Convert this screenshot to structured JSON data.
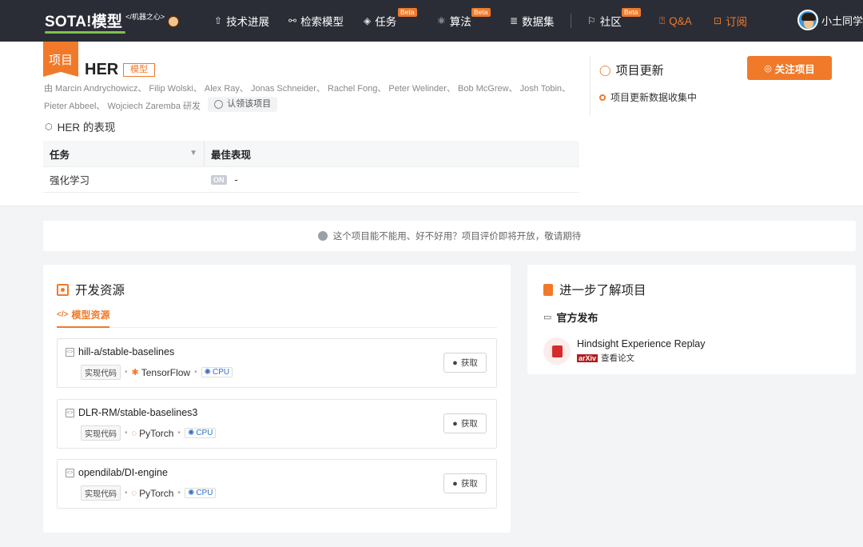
{
  "brand": {
    "logo_text": "SOTA!模型",
    "logo_sub": "</机器之心>"
  },
  "nav": {
    "items": [
      {
        "icon": "progress-icon",
        "label": "技术进展"
      },
      {
        "icon": "search-model-icon",
        "label": "检索模型"
      },
      {
        "icon": "task-icon",
        "label": "任务",
        "badge": "Beta"
      },
      {
        "icon": "algorithm-icon",
        "label": "算法",
        "badge": "Beta"
      },
      {
        "icon": "dataset-icon",
        "label": "数据集"
      },
      {
        "icon": "community-icon",
        "label": "社区",
        "badge": "Beta"
      },
      {
        "icon": "qa-icon",
        "label": "Q&A"
      },
      {
        "icon": "subscribe-icon",
        "label": "订阅"
      }
    ],
    "user_name": "小土同学"
  },
  "project": {
    "tag": "项目",
    "name": "HER",
    "type": "模型",
    "authors": "由 Marcin Andrychowicz、 Filip Wolski、 Alex Ray、 Jonas Schneider、 Rachel Fong、 Peter Welinder、 Bob McGrew、 Josh Tobin、 Pieter Abbeel、 Wojciech Zaremba 研发",
    "claim_label": "认领该项目",
    "perf_title": "HER 的表现",
    "table": {
      "headers": [
        "任务",
        "最佳表现"
      ],
      "rows": [
        {
          "task": "强化学习",
          "badge": "ON",
          "best": "-"
        }
      ]
    }
  },
  "updates": {
    "title": "项目更新",
    "follow_label": "关注项目",
    "item": "项目更新数据收集中"
  },
  "notice": "这个项目能不能用、好不好用？项目评价即将开放，敬请期待",
  "dev": {
    "title": "开发资源",
    "tab": "模型资源",
    "repos": [
      {
        "name": "hill-a/stable-baselines",
        "tag": "实现代码",
        "framework": "TensorFlow",
        "device": "CPU",
        "action": "获取"
      },
      {
        "name": "DLR-RM/stable-baselines3",
        "tag": "实现代码",
        "framework": "PyTorch",
        "device": "CPU",
        "action": "获取"
      },
      {
        "name": "opendilab/DI-engine",
        "tag": "实现代码",
        "framework": "PyTorch",
        "device": "CPU",
        "action": "获取"
      }
    ]
  },
  "learn": {
    "title": "进一步了解项目",
    "subtitle": "官方发布",
    "paper_title": "Hindsight Experience Replay",
    "paper_source": "arXiv",
    "paper_link": "查看论文"
  },
  "colors": {
    "accent": "#f07a2a",
    "nav_bg": "#2a2d35",
    "arxiv": "#b31b1b"
  }
}
